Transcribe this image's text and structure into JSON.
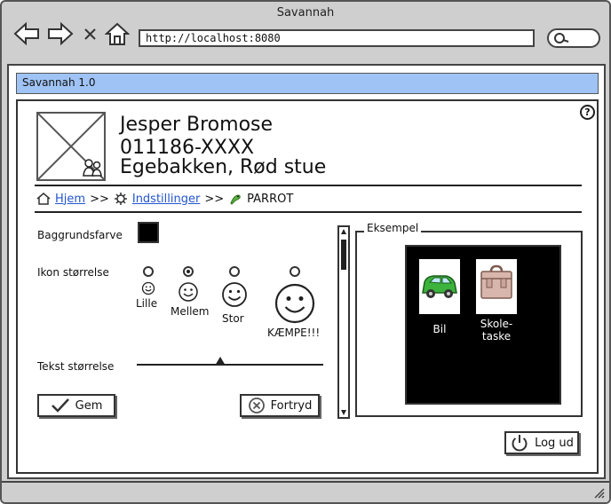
{
  "browser": {
    "title": "Savannah",
    "url": "http://localhost:8080"
  },
  "app": {
    "title": "Savannah 1.0"
  },
  "user": {
    "name": "Jesper Bromose",
    "cpr": "011186-XXXX",
    "place": "Egebakken, Rød stue"
  },
  "breadcrumb": {
    "home": "Hjem",
    "sep": ">>",
    "settings": "Indstillinger",
    "current": "PARROT"
  },
  "settings": {
    "bg_label": "Baggrundsfarve",
    "bg_color": "#000000",
    "icon_size_label": "Ikon størrelse",
    "icon_sizes": [
      {
        "label": "Lille",
        "selected": false
      },
      {
        "label": "Mellem",
        "selected": true
      },
      {
        "label": "Stor",
        "selected": false
      },
      {
        "label": "KÆMPE!!!",
        "selected": false
      }
    ],
    "text_size_label": "Tekst størrelse",
    "save_label": "Gem",
    "cancel_label": "Fortryd"
  },
  "example": {
    "legend": "Eksempel",
    "items": [
      {
        "label": "Bil",
        "icon": "car-icon"
      },
      {
        "label": "Skole-\ntaske",
        "icon": "schoolbag-icon"
      }
    ]
  },
  "logout_label": "Log ud",
  "colors": {
    "app_bar": "#9fc3f5",
    "link": "#2255cc",
    "car": "#3cb33c"
  }
}
